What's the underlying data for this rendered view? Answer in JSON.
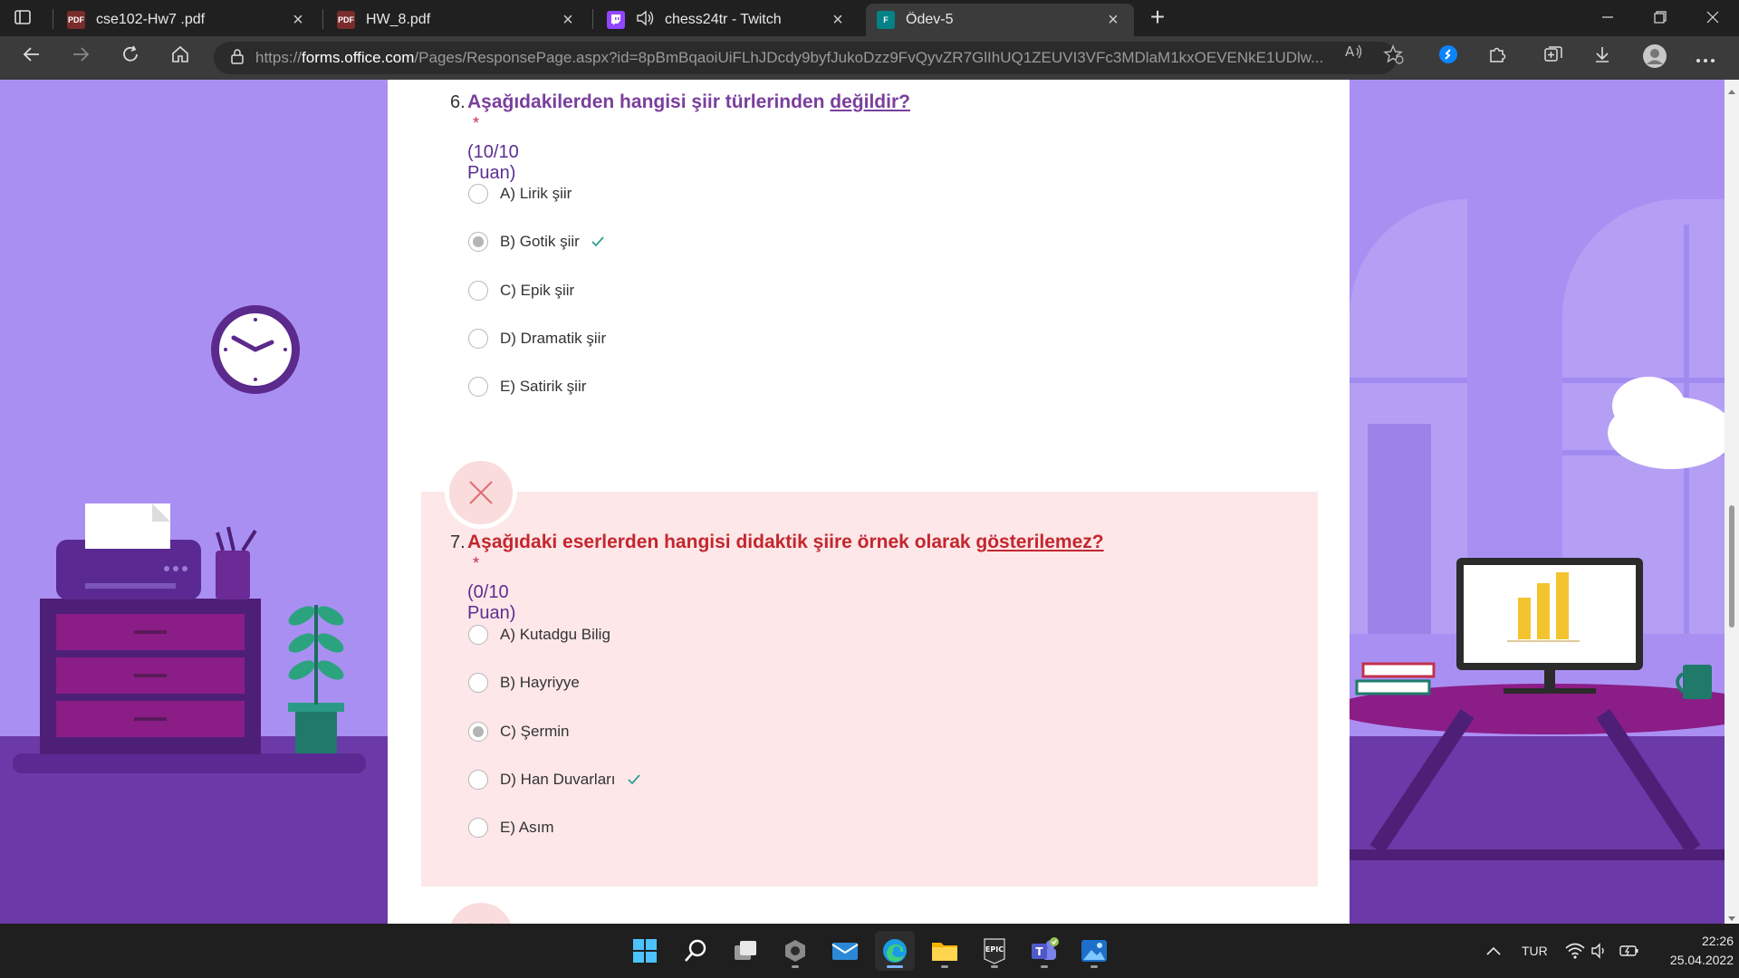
{
  "browser": {
    "tabs": [
      {
        "title": "cse102-Hw7 .pdf",
        "icon": "pdf-icon",
        "close": "×"
      },
      {
        "title": "HW_8.pdf",
        "icon": "pdf-icon",
        "close": "×"
      },
      {
        "title": "chess24tr - Twitch",
        "icon": "twitch-icon",
        "close": "×"
      },
      {
        "title": "Ödev-5",
        "icon": "forms-icon",
        "close": "×",
        "active": true
      }
    ],
    "new_tab": "+",
    "url_prefix": "https://",
    "url_host": "forms.office.com",
    "url_rest": "/Pages/ResponsePage.aspx?id=8pBmBqaoiUiFLhJDcdy9byfJukoDzz9FvQyvZR7GlIhUQ1ZEUVI3VFc3MDlaM1kxOEVENkE1UDlw..."
  },
  "questions": [
    {
      "number": "6.",
      "text_before": "Aşağıdakilerden hangisi şiir türlerinden ",
      "text_underlined": "değildir?",
      "required_mark": "*",
      "points": "(10/10 Puan)",
      "options": [
        {
          "label": "A) Lirik şiir",
          "selected": false,
          "correct": false
        },
        {
          "label": "B) Gotik şiir",
          "selected": true,
          "correct": true
        },
        {
          "label": "C) Epik şiir",
          "selected": false,
          "correct": false
        },
        {
          "label": "D) Dramatik şiir",
          "selected": false,
          "correct": false
        },
        {
          "label": "E) Satirik şiir",
          "selected": false,
          "correct": false
        }
      ]
    },
    {
      "number": "7.",
      "text_before": "Aşağıdaki eserlerden hangisi didaktik şiire örnek olarak ",
      "text_underlined": "gösterilemez?",
      "required_mark": "*",
      "points": "(0/10 Puan)",
      "status": "incorrect",
      "options": [
        {
          "label": "A) Kutadgu Bilig",
          "selected": false,
          "correct": false
        },
        {
          "label": "B) Hayriyye",
          "selected": false,
          "correct": false
        },
        {
          "label": "C) Şermin",
          "selected": true,
          "correct": false
        },
        {
          "label": "D) Han Duvarları",
          "selected": false,
          "correct": true
        },
        {
          "label": "E) Asım",
          "selected": false,
          "correct": false
        }
      ]
    }
  ],
  "colors": {
    "question_title_ok": "#7a3e9d",
    "question_title_wrong": "#c4262e",
    "points": "#5c2e91",
    "check": "#2f9f8f"
  },
  "taskbar": {
    "apps": [
      "windows-start",
      "search",
      "task-view",
      "settings",
      "mail",
      "edge",
      "file-explorer",
      "epic-games",
      "teams",
      "photos"
    ],
    "epic_label": "EPIC",
    "language": "TUR",
    "time": "22:26",
    "date": "25.04.2022"
  }
}
